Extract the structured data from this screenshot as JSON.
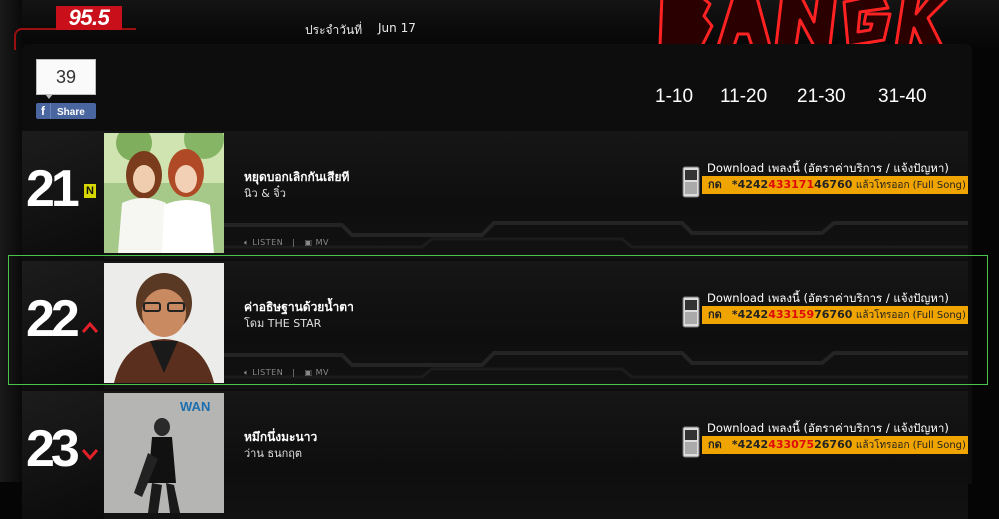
{
  "header": {
    "station_logo": "95.5",
    "date_label": "ประจำวันที่",
    "date_value": "Jun 17",
    "brand_word": "BANGKOK"
  },
  "social": {
    "like_count": "39",
    "share_label": "Share",
    "facebook_glyph": "f"
  },
  "ranges": [
    "1-10",
    "11-20",
    "21-30",
    "31-40"
  ],
  "songs": [
    {
      "rank": "21",
      "badge": "N",
      "movement": "new",
      "title": "หยุดบอกเลิกกันเสียที",
      "artist": "นิว & จิ๋ว",
      "listen_label": "LISTEN",
      "mv_label": "MV",
      "download_text": "Download เพลงนี้ (อัตราค่าบริการ / แจ้งปัญหา)",
      "code_prefix_label": "กด",
      "code_star": "*4242",
      "code_id": "433171",
      "code_suffix": "46760",
      "code_tail": "แล้วโทรออก (Full Song)"
    },
    {
      "rank": "22",
      "badge": "",
      "movement": "up",
      "title": "ค่าอธิษฐานด้วยน้ำตา",
      "artist": "โดม THE STAR",
      "listen_label": "LISTEN",
      "mv_label": "MV",
      "download_text": "Download เพลงนี้ (อัตราค่าบริการ / แจ้งปัญหา)",
      "code_prefix_label": "กด",
      "code_star": "*4242",
      "code_id": "433159",
      "code_suffix": "76760",
      "code_tail": "แล้วโทรออก (Full Song)"
    },
    {
      "rank": "23",
      "badge": "",
      "movement": "down",
      "title": "หมึกนึ่งมะนาว",
      "artist": "ว่าน ธนกฤต",
      "cover_text": "WAN",
      "listen_label": "",
      "mv_label": "",
      "download_text": "Download เพลงนี้ (อัตราค่าบริการ / แจ้งปัญหา)",
      "code_prefix_label": "กด",
      "code_star": "*4242",
      "code_id": "433075",
      "code_suffix": "26760",
      "code_tail": "แล้วโทรออก (Full Song)"
    }
  ],
  "colors": {
    "accent_orange": "#f0a400",
    "code_red": "#e00a0a",
    "brand_red": "#c9101a",
    "highlight_green": "#49c649",
    "badge_yellow": "#d7d700"
  },
  "icons": [
    "facebook-icon",
    "speaker-icon",
    "tv-icon",
    "phone-icon",
    "arrow-up-icon",
    "arrow-down-icon"
  ]
}
